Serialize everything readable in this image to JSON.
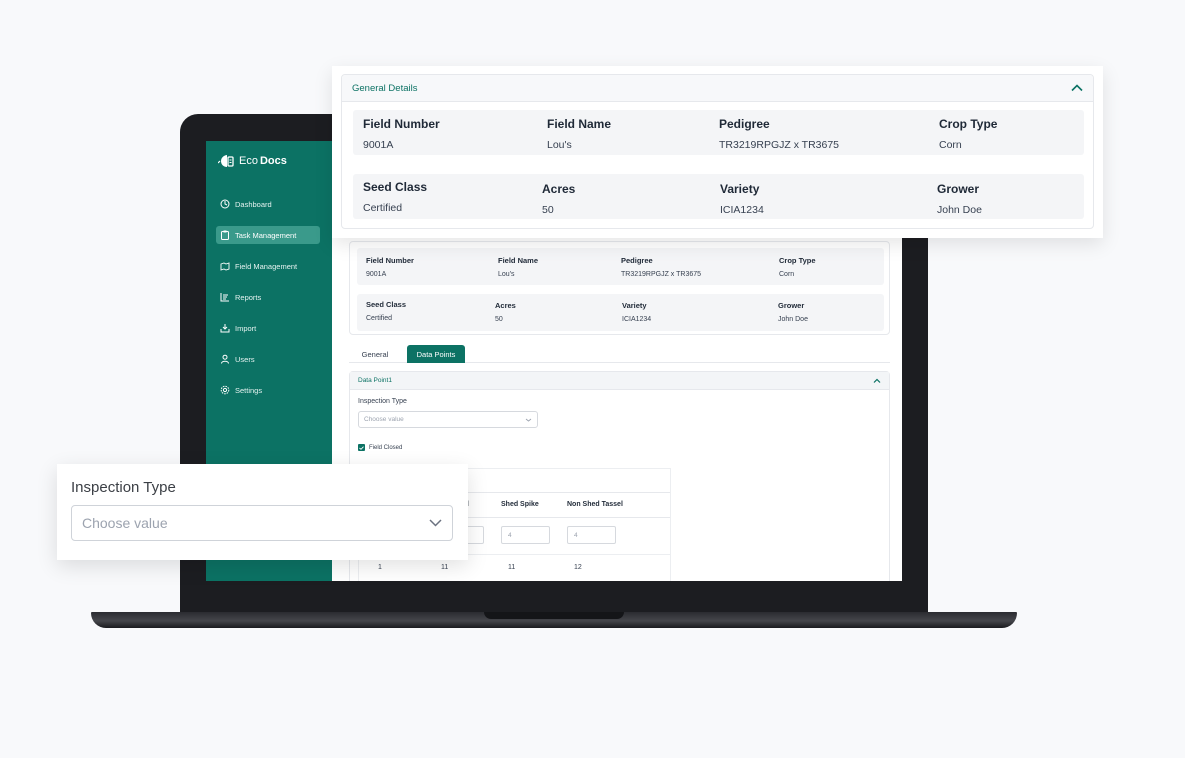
{
  "app": {
    "logo_prefix": "Eco",
    "logo_bold": "Docs"
  },
  "sidebar": {
    "items": [
      {
        "label": "Dashboard",
        "icon": "dashboard-icon",
        "active": false
      },
      {
        "label": "Task Management",
        "icon": "clipboard-icon",
        "active": true
      },
      {
        "label": "Field Management",
        "icon": "map-icon",
        "active": false
      },
      {
        "label": "Reports",
        "icon": "reports-icon",
        "active": false
      },
      {
        "label": "Import",
        "icon": "import-icon",
        "active": false
      },
      {
        "label": "Users",
        "icon": "user-icon",
        "active": false
      },
      {
        "label": "Settings",
        "icon": "gear-icon",
        "active": false
      }
    ]
  },
  "details": {
    "row1": [
      {
        "label": "Field Number",
        "value": "9001A"
      },
      {
        "label": "Field Name",
        "value": "Lou's"
      },
      {
        "label": "Pedigree",
        "value": "TR3219RPGJZ x TR3675"
      },
      {
        "label": "Crop Type",
        "value": "Corn"
      }
    ],
    "row2": [
      {
        "label": "Seed Class",
        "value": "Certified"
      },
      {
        "label": "Acres",
        "value": "50"
      },
      {
        "label": "Variety",
        "value": "ICIA1234"
      },
      {
        "label": "Grower",
        "value": "John Doe"
      }
    ]
  },
  "general_details": {
    "title": "General Details"
  },
  "tabs": {
    "general": "General",
    "data_points": "Data Points"
  },
  "data_point": {
    "title": "Data Point1",
    "inspection_label": "Inspection Type",
    "inspection_placeholder": "Choose value",
    "field_closed_label": "Field Closed",
    "table": {
      "headers": [
        "el",
        "Shed Spike",
        "Non Shed Tassel"
      ],
      "inputs": [
        "",
        "4",
        "4"
      ],
      "row": [
        "1",
        "11",
        "11",
        "12"
      ]
    }
  },
  "inspection_popout": {
    "label": "Inspection Type",
    "placeholder": "Choose value"
  },
  "colors": {
    "brand": "#0c7264",
    "active_nav": "#3a9a8b"
  }
}
